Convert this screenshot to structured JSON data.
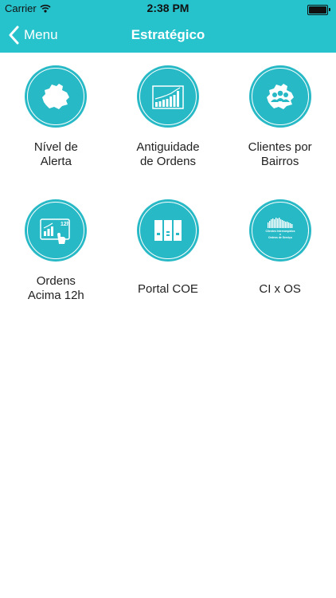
{
  "status_bar": {
    "carrier": "Carrier",
    "time": "2:38 PM"
  },
  "navbar": {
    "back_label": "Menu",
    "title": "Estratégico"
  },
  "colors": {
    "accent": "#27c3cd",
    "icon_circle": "#27b9c6"
  },
  "tiles": [
    {
      "label_line1": "Nível de",
      "label_line2": "Alerta",
      "icon": "map-icon"
    },
    {
      "label_line1": "Antiguidade",
      "label_line2": "de Ordens",
      "icon": "bar-chart-icon"
    },
    {
      "label_line1": "Clientes por",
      "label_line2": "Bairros",
      "icon": "map-users-icon"
    },
    {
      "label_line1": "Ordens",
      "label_line2": "Acima 12h",
      "icon": "touch-chart-icon"
    },
    {
      "label_line1": "Portal COE",
      "icon": "panels-icon"
    },
    {
      "label_line1": "CI x OS",
      "icon": "ci-os-icon",
      "icon_text_top": "Clientes Interrompidos",
      "icon_text_mid": "x",
      "icon_text_bottom": "Ordens de Serviço"
    }
  ]
}
